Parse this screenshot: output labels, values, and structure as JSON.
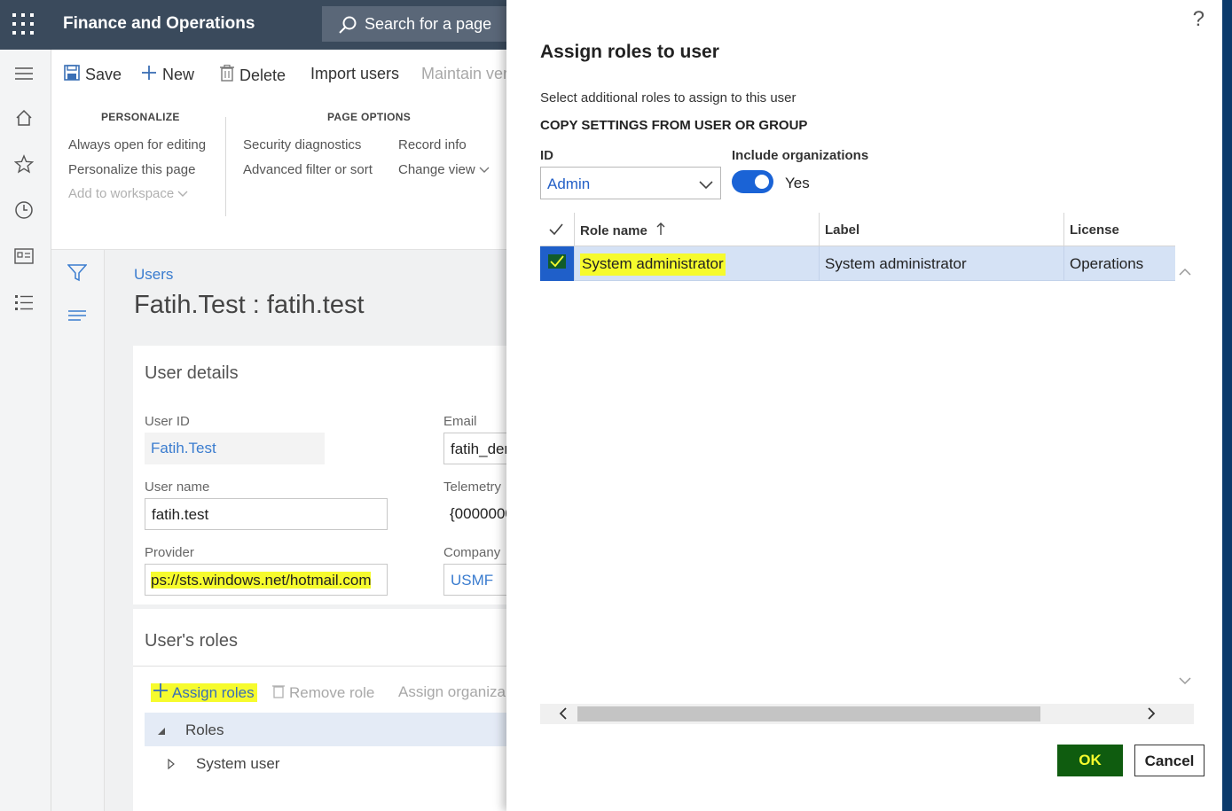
{
  "header": {
    "app_title": "Finance and Operations",
    "search_placeholder": "Search for a page"
  },
  "actions": {
    "save": "Save",
    "new": "New",
    "delete": "Delete",
    "import_users": "Import users",
    "maintain": "Maintain ver"
  },
  "ribbon": {
    "personalize_head": "PERSONALIZE",
    "page_options_head": "PAGE OPTIONS",
    "always_open": "Always open for editing",
    "personalize_page": "Personalize this page",
    "add_workspace": "Add to workspace",
    "security_diag": "Security diagnostics",
    "advanced_filter": "Advanced filter or sort",
    "record_info": "Record info",
    "change_view": "Change view"
  },
  "page": {
    "breadcrumb": "Users",
    "title": "Fatih.Test : fatih.test"
  },
  "user_details": {
    "title": "User details",
    "user_id_label": "User ID",
    "user_id_value": "Fatih.Test",
    "email_label": "Email",
    "email_value": "fatih_der",
    "user_name_label": "User name",
    "user_name_value": "fatih.test",
    "telemetry_label": "Telemetry",
    "telemetry_value": "{0000000",
    "provider_label": "Provider",
    "provider_value": "ps://sts.windows.net/hotmail.com",
    "company_label": "Company",
    "company_value": "USMF"
  },
  "roles": {
    "title": "User's roles",
    "assign": "Assign roles",
    "remove": "Remove role",
    "assign_org": "Assign organiza",
    "tree_root": "Roles",
    "tree_child": "System user"
  },
  "dialog": {
    "help": "?",
    "title": "Assign roles to user",
    "subtitle": "Select additional roles to assign to this user",
    "section": "COPY SETTINGS FROM USER OR GROUP",
    "id_label": "ID",
    "id_value": "Admin",
    "include_org_label": "Include organizations",
    "include_org_value": "Yes",
    "columns": {
      "role_name": "Role name",
      "label": "Label",
      "license": "License"
    },
    "rows": [
      {
        "role_name": "System administrator",
        "label": "System administrator",
        "license": "Operations"
      }
    ],
    "ok": "OK",
    "cancel": "Cancel"
  },
  "colors": {
    "topbar": "#3a4a5c",
    "accent": "#1a63d6",
    "highlight": "#f6fb2d",
    "ok_button": "#0f5c0f"
  }
}
